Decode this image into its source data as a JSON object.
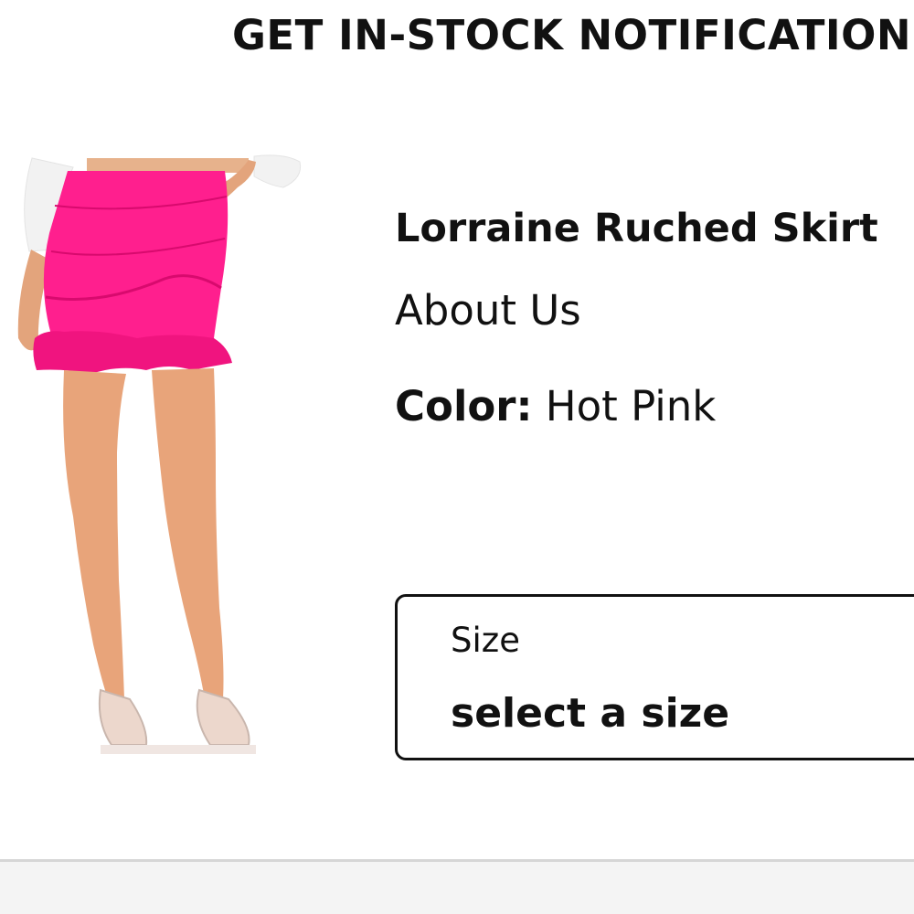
{
  "modal": {
    "title": "GET IN-STOCK NOTIFICATION"
  },
  "product": {
    "name": "Lorraine Ruched Skirt",
    "link_label": "About Us",
    "color_label": "Color:",
    "color_value": "Hot Pink",
    "image": "product-photo-pink-ruched-skirt"
  },
  "size_select": {
    "label": "Size",
    "value": "select a size"
  },
  "colors": {
    "accent": "#ff1f8e",
    "text": "#111111",
    "bottom_bar": "#f4f4f4"
  }
}
